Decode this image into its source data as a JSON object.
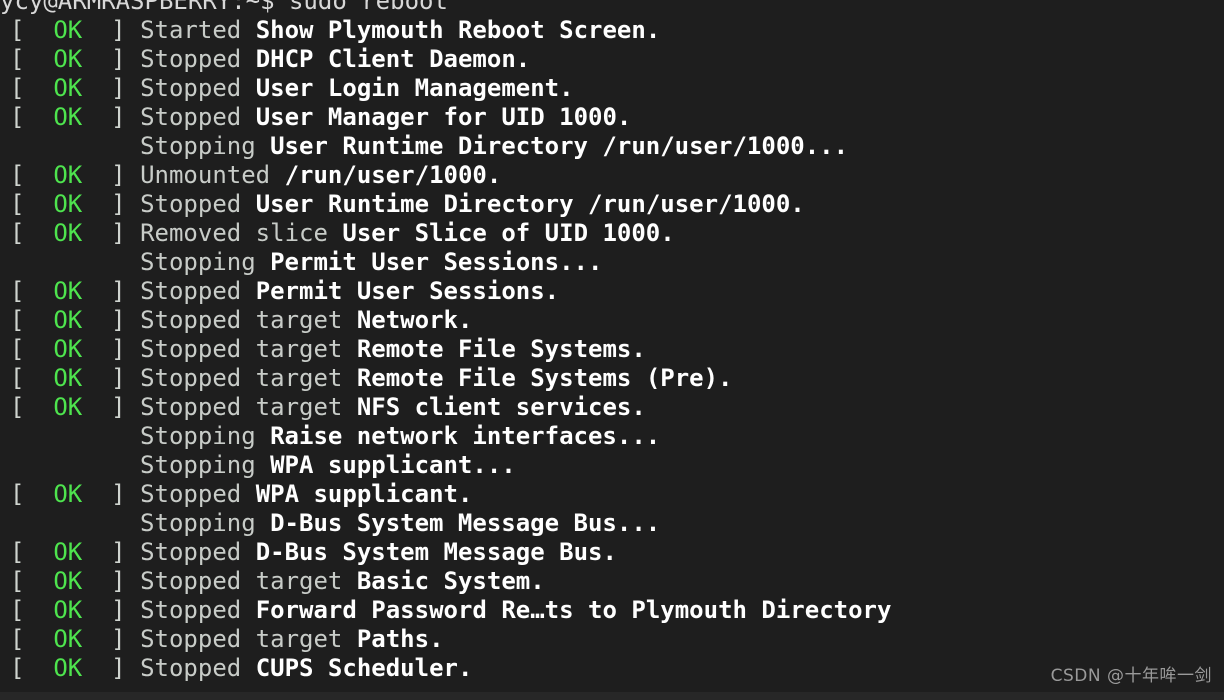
{
  "terminal": {
    "background_color": "#1e1e1e",
    "bottom_strip_color": "#272727",
    "ok_color": "#4ee44e",
    "bracket_color": "#cfd4cf",
    "verb_color": "#c8ccc8",
    "unit_color": "#ffffff",
    "prompt": {
      "text": "ycy@ARMRASPBERRY:~$ sudo reboot",
      "user_host": "ycy@ARMRASPBERRY",
      "path": "~",
      "sigil": "$",
      "command": "sudo reboot"
    },
    "status_tag": {
      "open_bracket": "[",
      "ok_label": "OK",
      "close_bracket": "]",
      "pad": "[  OK  ] "
    },
    "lines": [
      {
        "status": "ok",
        "verb": "Started",
        "unit": "Show Plymouth Reboot Screen."
      },
      {
        "status": "ok",
        "verb": "Stopped",
        "unit": "DHCP Client Daemon."
      },
      {
        "status": "ok",
        "verb": "Stopped",
        "unit": "User Login Management."
      },
      {
        "status": "ok",
        "verb": "Stopped",
        "unit": "User Manager for UID 1000."
      },
      {
        "status": "none",
        "verb": "Stopping",
        "unit": "User Runtime Directory /run/user/1000..."
      },
      {
        "status": "ok",
        "verb": "Unmounted",
        "unit": "/run/user/1000."
      },
      {
        "status": "ok",
        "verb": "Stopped",
        "unit": "User Runtime Directory /run/user/1000."
      },
      {
        "status": "ok",
        "verb": "Removed slice",
        "unit": "User Slice of UID 1000."
      },
      {
        "status": "none",
        "verb": "Stopping",
        "unit": "Permit User Sessions..."
      },
      {
        "status": "ok",
        "verb": "Stopped",
        "unit": "Permit User Sessions."
      },
      {
        "status": "ok",
        "verb": "Stopped target",
        "unit": "Network."
      },
      {
        "status": "ok",
        "verb": "Stopped target",
        "unit": "Remote File Systems."
      },
      {
        "status": "ok",
        "verb": "Stopped target",
        "unit": "Remote File Systems (Pre)."
      },
      {
        "status": "ok",
        "verb": "Stopped target",
        "unit": "NFS client services."
      },
      {
        "status": "none",
        "verb": "Stopping",
        "unit": "Raise network interfaces..."
      },
      {
        "status": "none",
        "verb": "Stopping",
        "unit": "WPA supplicant..."
      },
      {
        "status": "ok",
        "verb": "Stopped",
        "unit": "WPA supplicant."
      },
      {
        "status": "none",
        "verb": "Stopping",
        "unit": "D-Bus System Message Bus..."
      },
      {
        "status": "ok",
        "verb": "Stopped",
        "unit": "D-Bus System Message Bus."
      },
      {
        "status": "ok",
        "verb": "Stopped target",
        "unit": "Basic System."
      },
      {
        "status": "ok",
        "verb": "Stopped",
        "unit": "Forward Password Re…ts to Plymouth Directory"
      },
      {
        "status": "ok",
        "verb": "Stopped target",
        "unit": "Paths."
      },
      {
        "status": "ok",
        "verb": "Stopped",
        "unit": "CUPS Scheduler."
      }
    ]
  },
  "watermark": {
    "text": "CSDN @十年哞一剑"
  }
}
